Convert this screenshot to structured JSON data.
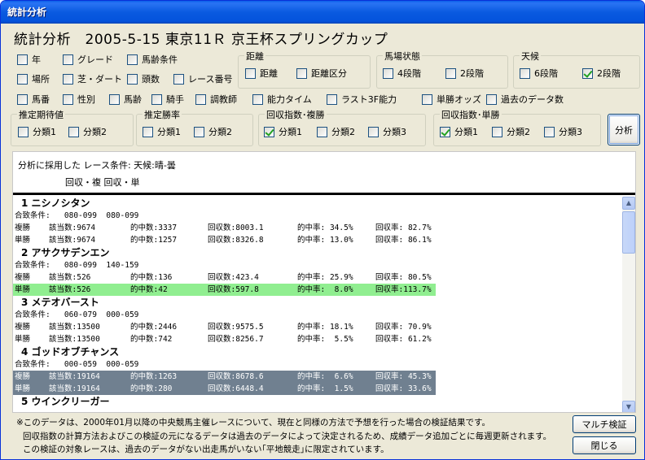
{
  "window": {
    "title": "統計分析"
  },
  "header": {
    "title": "統計分析　2005-5-15 東京11Ｒ 京王杯スプリングカップ"
  },
  "options": {
    "year": {
      "label": "年",
      "checked": false
    },
    "grade": {
      "label": "グレード",
      "checked": false
    },
    "age_cond": {
      "label": "馬齢条件",
      "checked": false
    },
    "place": {
      "label": "場所",
      "checked": false
    },
    "surface": {
      "label": "芝・ダート",
      "checked": false
    },
    "head_count": {
      "label": "頭数",
      "checked": false
    },
    "race_no": {
      "label": "レース番号",
      "checked": false
    },
    "horse_no": {
      "label": "馬番",
      "checked": false
    },
    "sex": {
      "label": "性別",
      "checked": false
    },
    "horse_age": {
      "label": "馬齢",
      "checked": false
    },
    "jockey": {
      "label": "騎手",
      "checked": false
    },
    "trainer": {
      "label": "調教師",
      "checked": false
    },
    "ability_time": {
      "label": "能力タイム",
      "checked": false
    },
    "last3f": {
      "label": "ラスト3F能力",
      "checked": false
    },
    "win_odds": {
      "label": "単勝オッズ",
      "checked": false
    },
    "past_count": {
      "label": "過去のデータ数",
      "checked": false
    }
  },
  "groups": {
    "distance": {
      "title": "距離",
      "a": "距離",
      "b": "距離区分"
    },
    "track": {
      "title": "馬場状態",
      "a": "4段階",
      "b": "2段階"
    },
    "weather": {
      "title": "天候",
      "a": "6段階",
      "b": "2段階"
    },
    "expect": {
      "title": "推定期待値",
      "a": "分類1",
      "b": "分類2"
    },
    "winrate": {
      "title": "推定勝率",
      "a": "分類1",
      "b": "分類2"
    },
    "recov_place": {
      "title": "回収指数･複勝",
      "a": "分類1",
      "b": "分類2",
      "c": "分類3"
    },
    "recov_win": {
      "title": "回収指数･単勝",
      "a": "分類1",
      "b": "分類2",
      "c": "分類3"
    }
  },
  "buttons": {
    "analyze": "分析",
    "multi": "マルチ検証",
    "close": "閉じる"
  },
  "results": {
    "condition_line": "分析に採用した レース条件:  天候:晴-曇",
    "columns_line": "回収・複 回収・単",
    "entries": [
      {
        "title": "1  ニシノシタン",
        "cond": "合致条件:   080-099  080-099",
        "rows": [
          {
            "type": "複勝",
            "count": "該当数:9674",
            "hits": "的中数:3337",
            "recov": "回収数:8003.1",
            "hitrate": "的中率: 34.5%",
            "rate": "回収率: 82.7%",
            "hl": ""
          },
          {
            "type": "単勝",
            "count": "該当数:9674",
            "hits": "的中数:1257",
            "recov": "回収数:8326.8",
            "hitrate": "的中率: 13.0%",
            "rate": "回収率: 86.1%",
            "hl": ""
          }
        ]
      },
      {
        "title": "2  アサクサデンエン",
        "cond": "合致条件:   080-099  140-159",
        "rows": [
          {
            "type": "複勝",
            "count": "該当数:526",
            "hits": "的中数:136",
            "recov": "回収数:423.4",
            "hitrate": "的中率: 25.9%",
            "rate": "回収率: 80.5%",
            "hl": ""
          },
          {
            "type": "単勝",
            "count": "該当数:526",
            "hits": "的中数:42",
            "recov": "回収数:597.8",
            "hitrate": "的中率:  8.0%",
            "rate": "回収率:113.7%",
            "hl": "green"
          }
        ]
      },
      {
        "title": "3  メテオバースト",
        "cond": "合致条件:   060-079  000-059",
        "rows": [
          {
            "type": "複勝",
            "count": "該当数:13500",
            "hits": "的中数:2446",
            "recov": "回収数:9575.5",
            "hitrate": "的中率: 18.1%",
            "rate": "回収率: 70.9%",
            "hl": ""
          },
          {
            "type": "単勝",
            "count": "該当数:13500",
            "hits": "的中数:742",
            "recov": "回収数:8256.7",
            "hitrate": "的中率:  5.5%",
            "rate": "回収率: 61.2%",
            "hl": ""
          }
        ]
      },
      {
        "title": "4  ゴッドオブチャンス",
        "cond": "合致条件:   000-059  000-059",
        "rows": [
          {
            "type": "複勝",
            "count": "該当数:19164",
            "hits": "的中数:1263",
            "recov": "回収数:8678.6",
            "hitrate": "的中率:  6.6%",
            "rate": "回収率: 45.3%",
            "hl": "gray"
          },
          {
            "type": "単勝",
            "count": "該当数:19164",
            "hits": "的中数:280",
            "recov": "回収数:6448.4",
            "hitrate": "的中率:  1.5%",
            "rate": "回収率: 33.6%",
            "hl": "gray"
          }
        ]
      },
      {
        "title": "5  ウインクリーガー",
        "cond": "",
        "rows": []
      }
    ]
  },
  "notes": {
    "line1": "※このデータは、2000年01月以降の中央競馬主催レースについて、現在と同様の方法で予想を行った場合の検証結果です。",
    "line2": "回収指数の計算方法およびこの検証の元になるデータは過去のデータによって決定されるため、成績データ追加ごとに毎週更新されます。",
    "line3": "この検証の対象レースは、過去のデータがない出走馬がいない｢平地競走｣に限定されています。"
  }
}
